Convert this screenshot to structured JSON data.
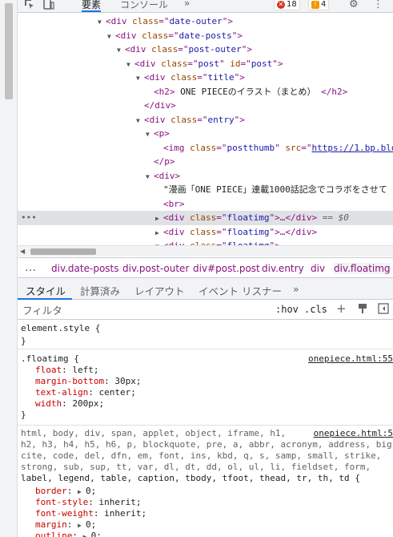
{
  "toolbar": {
    "tabs": [
      "要素",
      "コンソール"
    ],
    "more": "»",
    "errors": "18",
    "warnings": "4",
    "icons": [
      "inspect-icon",
      "device-icon",
      "gear-icon",
      "kebab-menu-icon"
    ]
  },
  "dom": {
    "rows": [
      {
        "tag": "div",
        "attrs": [
          [
            "class",
            "date-outer"
          ]
        ]
      },
      {
        "tag": "div",
        "attrs": [
          [
            "class",
            "date-posts"
          ]
        ]
      },
      {
        "tag": "div",
        "attrs": [
          [
            "class",
            "post-outer"
          ]
        ]
      },
      {
        "tag": "div",
        "attrs": [
          [
            "class",
            "post"
          ],
          [
            "id",
            "post"
          ]
        ]
      },
      {
        "tag": "div",
        "attrs": [
          [
            "class",
            "title"
          ]
        ]
      },
      {
        "h2_text": "ONE PIECEのイラスト（まとめ）"
      },
      {
        "close": "</div>"
      },
      {
        "tag": "div",
        "attrs": [
          [
            "class",
            "entry"
          ]
        ]
      },
      {
        "tag": "p"
      },
      {
        "img_class": "postthumb",
        "img_src": "https://1.bp.blo"
      },
      {
        "close": "</p>"
      },
      {
        "tag": "div"
      },
      {
        "text": "\"漫画「ONE PIECE」連載1000話記念でコラボをさせて"
      },
      {
        "br": "<br>"
      },
      {
        "selected": true,
        "tag": "div",
        "class": "floatimg",
        "suffix": "…</div>",
        "eq": "== $0"
      },
      {
        "tag": "div",
        "class": "floatimg",
        "suffix": "…</div>"
      },
      {
        "tag": "div",
        "class": "floatimg"
      }
    ]
  },
  "breadcrumbs": {
    "more": "…",
    "items": [
      "div.date-posts",
      "div.post-outer",
      "div#post.post",
      "div.entry",
      "div",
      "div.floatimg"
    ]
  },
  "styles_tabs": {
    "items": [
      "スタイル",
      "計算済み",
      "レイアウト",
      "イベント リスナー"
    ],
    "more": "»"
  },
  "filter": {
    "placeholder": "フィルタ",
    "hov": ":hov",
    "cls": ".cls",
    "plus": "+"
  },
  "rules": {
    "element_style": {
      "selector": "element.style {",
      "close": "}"
    },
    "floatimg": {
      "selector": ".floatimg {",
      "source": "onepiece.html:55",
      "props": [
        [
          "float",
          "left"
        ],
        [
          "margin-bottom",
          "30px"
        ],
        [
          "text-align",
          "center"
        ],
        [
          "width",
          "200px"
        ]
      ],
      "close": "}"
    },
    "reset": {
      "source": "onepiece.html:5",
      "selector_lines": [
        "html, body, div, span, applet, object, iframe, h1,",
        "h2, h3, h4, h5, h6, p, blockquote, pre, a, abbr, acronym, address, big,",
        "cite, code, del, dfn, em, font, ins, kbd, q, s, samp, small, strike,",
        "strong, sub, sup, tt, var, dl, dt, dd, ol, ul, li, fieldset, form,",
        "label, legend, table, caption, tbody, tfoot, thead, tr, th, td {"
      ],
      "props": [
        [
          "border",
          "0"
        ],
        [
          "font-style",
          "inherit"
        ],
        [
          "font-weight",
          "inherit"
        ],
        [
          "margin",
          "0"
        ],
        [
          "outline",
          "0"
        ]
      ]
    }
  }
}
